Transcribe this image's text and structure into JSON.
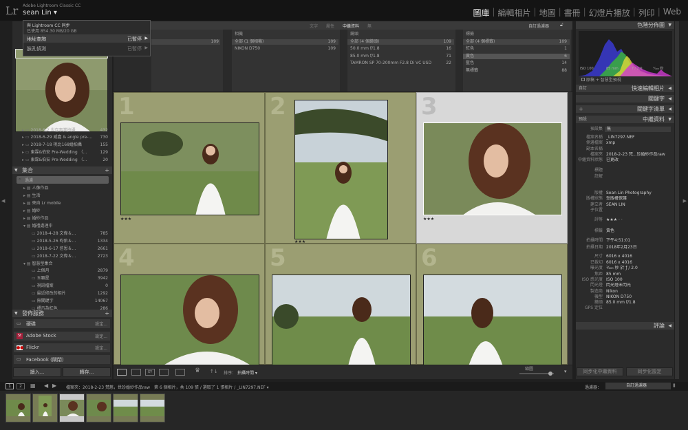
{
  "app": {
    "name": "Adobe Lightroom Classic CC",
    "user": "sean Lin",
    "logo": "Lr"
  },
  "modules": [
    "圖庫",
    "編輯相片",
    "地圖",
    "書冊",
    "幻燈片播放",
    "列印",
    "Web"
  ],
  "active_module": "圖庫",
  "dropdown": {
    "line1": "與 Lightroom CC 同步",
    "line2": "已使用 854.30 MB/20 GB",
    "items": [
      {
        "label": "地址查詢",
        "status": "已暫停"
      },
      {
        "label": "臉孔偵測",
        "status": "已暫停"
      }
    ]
  },
  "left": {
    "folders": [
      {
        "name": "2018-6-2 世存事業拍攝",
        "count": "432"
      },
      {
        "name": "2018-6-29 威嘉 & angle pre-...",
        "count": "730"
      },
      {
        "name": "2018-7-18 桃比168婚拍攝",
        "count": "155"
      },
      {
        "name": "東霖&伯安 Pre-Wedding （...",
        "count": "129"
      },
      {
        "name": "東霖&伯安 Pre-Wedding （...",
        "count": "20"
      }
    ],
    "collections_header": "集合",
    "search_placeholder": "過濾",
    "collections": [
      {
        "name": "人像作品",
        "count": "",
        "level": 1
      },
      {
        "name": "生活",
        "count": "",
        "level": 1
      },
      {
        "name": "來自 Lr mobile",
        "count": "",
        "level": 1
      },
      {
        "name": "婚紗",
        "count": "",
        "level": 1
      },
      {
        "name": "婚紗作品",
        "count": "",
        "level": 1
      },
      {
        "name": "婚禮處理中",
        "count": "",
        "level": 1
      },
      {
        "name": "2018-4-28 文偉＆...",
        "count": "785",
        "level": 2
      },
      {
        "name": "2018-5-26 昀佑＆...",
        "count": "1334",
        "level": 2
      },
      {
        "name": "2018-6-17 信恩＆...",
        "count": "2661",
        "level": 2
      },
      {
        "name": "2018-7-22 文偉＆...",
        "count": "2723",
        "level": 2
      },
      {
        "name": "智慧型集合",
        "count": "",
        "level": 1
      },
      {
        "name": "上個月",
        "count": "2879",
        "level": 2
      },
      {
        "name": "五顆星",
        "count": "3942",
        "level": 2
      },
      {
        "name": "視訊檔案",
        "count": "0",
        "level": 2
      },
      {
        "name": "最近修改的相片",
        "count": "1292",
        "level": 2
      },
      {
        "name": "無關鍵字",
        "count": "14067",
        "level": 2
      },
      {
        "name": "標示為紅色",
        "count": "286",
        "level": 2
      }
    ],
    "publish_header": "發佈服務",
    "publish": [
      {
        "name": "硬碟",
        "action": "設定..."
      },
      {
        "name": "Adobe Stock",
        "action": "設定..."
      },
      {
        "name": "Flickr",
        "action": "設定..."
      },
      {
        "name": "Facebook (關閉)",
        "action": ""
      }
    ],
    "import_btn": "讀入...",
    "export_btn": "轉存..."
  },
  "filter_bar": {
    "tabs": [
      "文字",
      "屬性",
      "中繼資料",
      "無"
    ],
    "preset": "自訂過濾器"
  },
  "browser": [
    {
      "title": "",
      "items": [
        {
          "l": "",
          "c": "109"
        }
      ]
    },
    {
      "title": "相機",
      "items": [
        {
          "l": "全部 (1 個相機)",
          "c": "109"
        },
        {
          "l": "NIKON D750",
          "c": "109"
        }
      ]
    },
    {
      "title": "鏡頭",
      "items": [
        {
          "l": "全部 (4 個鏡頭)",
          "c": "109"
        },
        {
          "l": "50.0 mm f/1.8",
          "c": "16"
        },
        {
          "l": "85.0 mm f/1.8",
          "c": "71"
        },
        {
          "l": "TAMRON SP 70-200mm F2.8 Di VC USD A...",
          "c": "22"
        }
      ]
    },
    {
      "title": "標籤",
      "items": [
        {
          "l": "全部 (4 個標籤)",
          "c": "109"
        },
        {
          "l": "紅色",
          "c": "1"
        },
        {
          "l": "黃色",
          "c": "6"
        },
        {
          "l": "藍色",
          "c": "14"
        },
        {
          "l": "無標籤",
          "c": "88"
        }
      ]
    }
  ],
  "grid": {
    "cells": [
      "1",
      "2",
      "3",
      "4",
      "5",
      "6"
    ],
    "stars": [
      "★★★",
      "★★★",
      "★★★"
    ]
  },
  "toolbar": {
    "sort_label": "排序：",
    "sort_value": "拍攝時間",
    "thumb_label": "縮圖"
  },
  "right": {
    "histogram_title": "色階分佈圖",
    "exif": [
      "ISO 100",
      "85 mm",
      "f / 2.0",
      "¹⁄₄₀₀ 秒"
    ],
    "original_photo": "原稿 + 智慧型預視",
    "quick_dev": "快速編輯相片",
    "quick_dev_preset": "自訂",
    "keywords": "關鍵字",
    "keyword_list": "關鍵字清單",
    "metadata": "中繼資料",
    "metadata_preset": "預設",
    "preset_label": "預設集",
    "preset_value": "無",
    "meta": [
      {
        "k": "檔案名稱",
        "v": "_LIN7297.NEF"
      },
      {
        "k": "側邊檔案",
        "v": "xmp"
      },
      {
        "k": "副本名稱",
        "v": ""
      },
      {
        "k": "檔案夾",
        "v": "2018-2-23 梵...珍婚紗作品raw"
      },
      {
        "k": "中繼資料狀態",
        "v": "已更改"
      },
      {
        "k": "標題",
        "v": ""
      },
      {
        "k": "註解",
        "v": ""
      },
      {
        "k": "版權",
        "v": "Sean Lin Photography"
      },
      {
        "k": "版權狀態",
        "v": "受版權保護"
      },
      {
        "k": "建立者",
        "v": "SEAN LIN"
      },
      {
        "k": "子位置",
        "v": ""
      },
      {
        "k": "評等",
        "v": "★★★ · ·"
      },
      {
        "k": "標籤",
        "v": "黃色"
      },
      {
        "k": "拍攝時間",
        "v": "下午4:51:01"
      },
      {
        "k": "拍攝日期",
        "v": "2018年2月23日"
      },
      {
        "k": "尺寸",
        "v": "6016 x 4016"
      },
      {
        "k": "已裁切",
        "v": "6016 x 4016"
      },
      {
        "k": "曝光度",
        "v": "¹⁄₄₀₀ 秒 於 ƒ / 2.0"
      },
      {
        "k": "焦距",
        "v": "85 mm"
      },
      {
        "k": "ISO 感光度",
        "v": "ISO 100"
      },
      {
        "k": "閃光燈",
        "v": "閃光燈未閃光"
      },
      {
        "k": "製造商",
        "v": "Nikon"
      },
      {
        "k": "機型",
        "v": "NIKON D750"
      },
      {
        "k": "鏡頭",
        "v": "85.0 mm f/1.8"
      },
      {
        "k": "GPS 定位",
        "v": ""
      }
    ],
    "comments": "評論",
    "sync_meta": "同步化中繼資料",
    "sync_settings": "同步化設定"
  },
  "filmstrip": {
    "pages": [
      "1",
      "2"
    ],
    "info": "檔案夾：2018-2-23 梵慈，世珍婚紗作品raw　第 6 個相片，共 109 張 / 選取了 1 張相片 / _LIN7297.NEF ▾",
    "filter_label": "過濾器：",
    "filter_value": "自訂過濾器"
  },
  "colors": {
    "grid_bg": "#9b9e72",
    "selected_bg": "#d8d8d8",
    "panel": "#2b2b2b",
    "header": "#3a3a3a"
  }
}
